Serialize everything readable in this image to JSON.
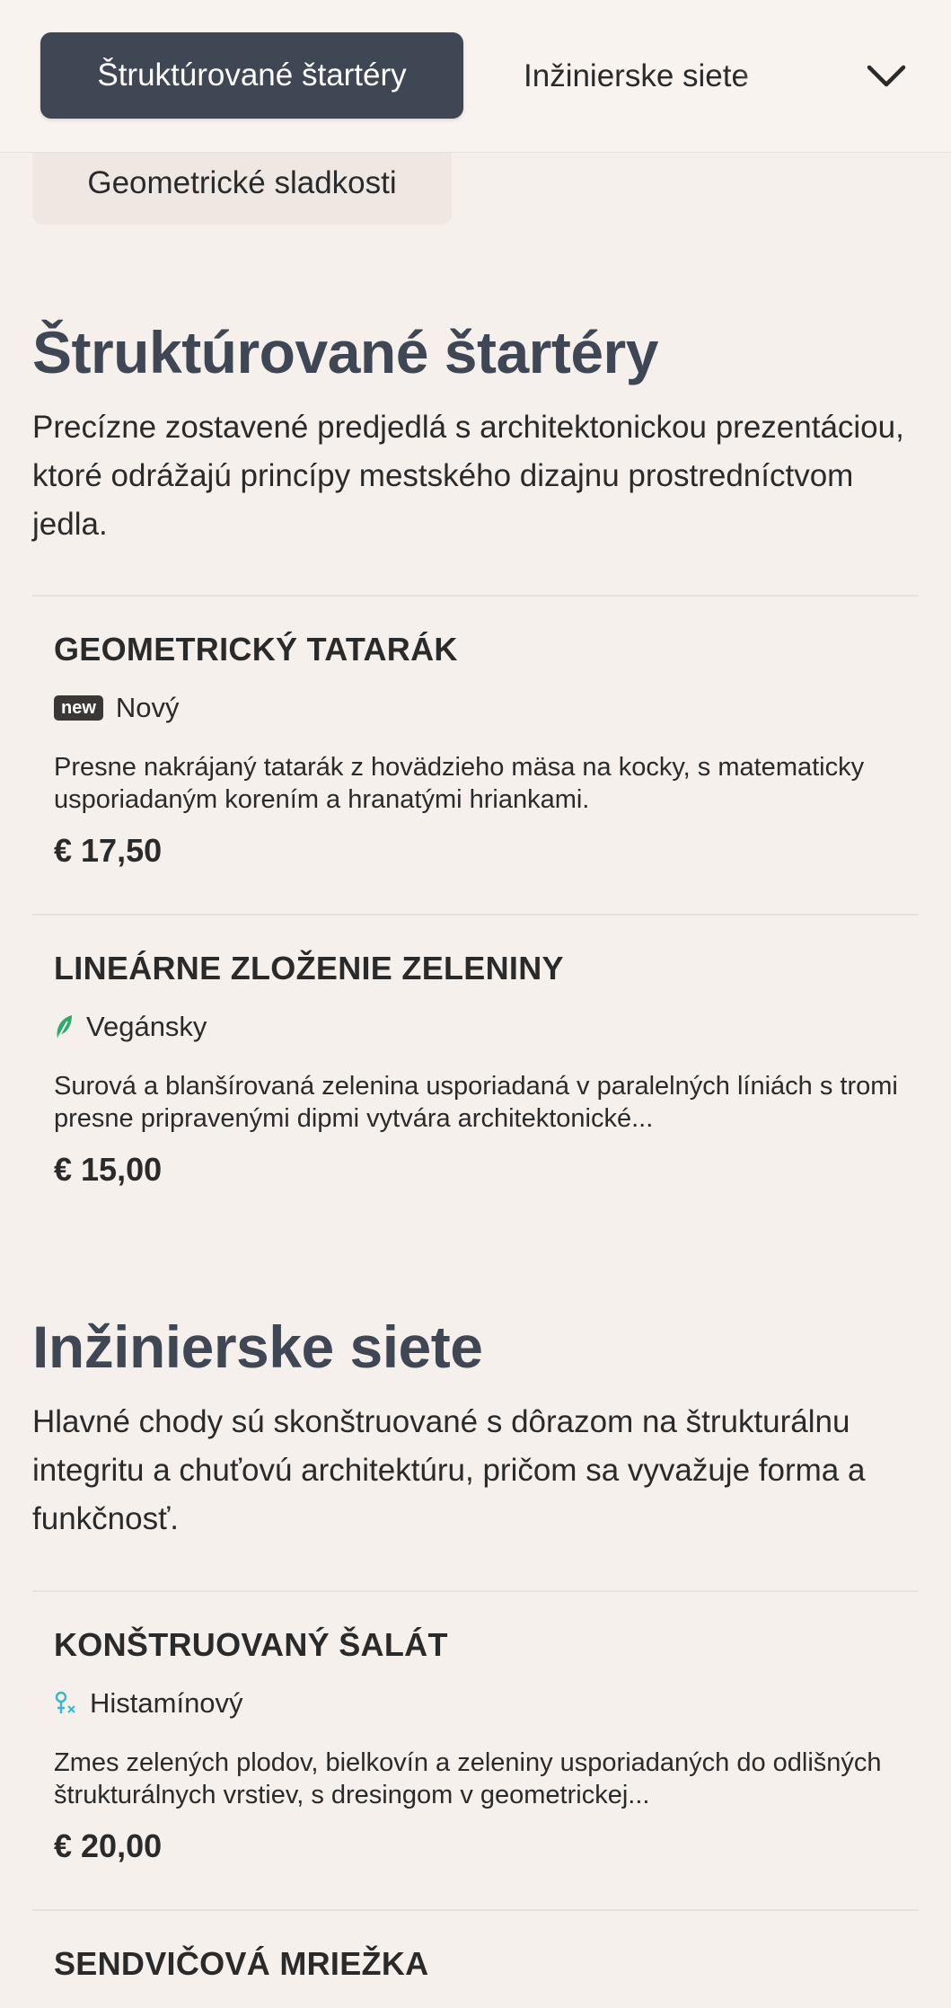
{
  "categories": {
    "active": "Štruktúrované štartéry",
    "next": "Inžinierske siete",
    "overflow": "Geometrické sladkosti"
  },
  "sections": [
    {
      "title": "Štruktúrované štartéry",
      "description": "Precízne zostavené predjedlá s architektonickou prezentáciou, ktoré odrážajú princípy mestského dizajnu prostredníctvom jedla.",
      "items": [
        {
          "name": "GEOMETRICKÝ TATARÁK",
          "badge": "new",
          "tag": "Nový",
          "description": "Presne nakrájaný tatarák z hovädzieho mäsa na kocky, s matematicky usporiadaným korením a hranatými hriankami.",
          "price": "€ 17,50"
        },
        {
          "name": "LINEÁRNE ZLOŽENIE ZELENINY",
          "tag": "Vegánsky",
          "description": "Surová a blanšírovaná zelenina usporiadaná v paralelných líniách s tromi presne pripravenými dipmi vytvára architektonické...",
          "price": "€ 15,00"
        }
      ]
    },
    {
      "title": "Inžinierske siete",
      "description": "Hlavné chody sú skonštruované s dôrazom na štrukturálnu integritu a chuťovú architektúru, pričom sa vyvažuje forma a funkčnosť.",
      "items": [
        {
          "name": "KONŠTRUOVANÝ ŠALÁT",
          "tag": "Histamínový",
          "description": "Zmes zelených plodov, bielkovín a zeleniny usporiadaných do odlišných štrukturálnych vrstiev, s dresingom v geometrickej...",
          "price": "€ 20,00"
        },
        {
          "name": "SENDVIČOVÁ MRIEŽKA"
        }
      ]
    }
  ],
  "icons": {
    "chevron": "chevron-down-icon",
    "vegan": "leaf-icon",
    "histamine": "histamine-icon"
  },
  "colors": {
    "background": "#f6f0ec",
    "accent": "#3e4753",
    "vegan": "#2eaa6a",
    "histamine": "#35b8c9"
  }
}
